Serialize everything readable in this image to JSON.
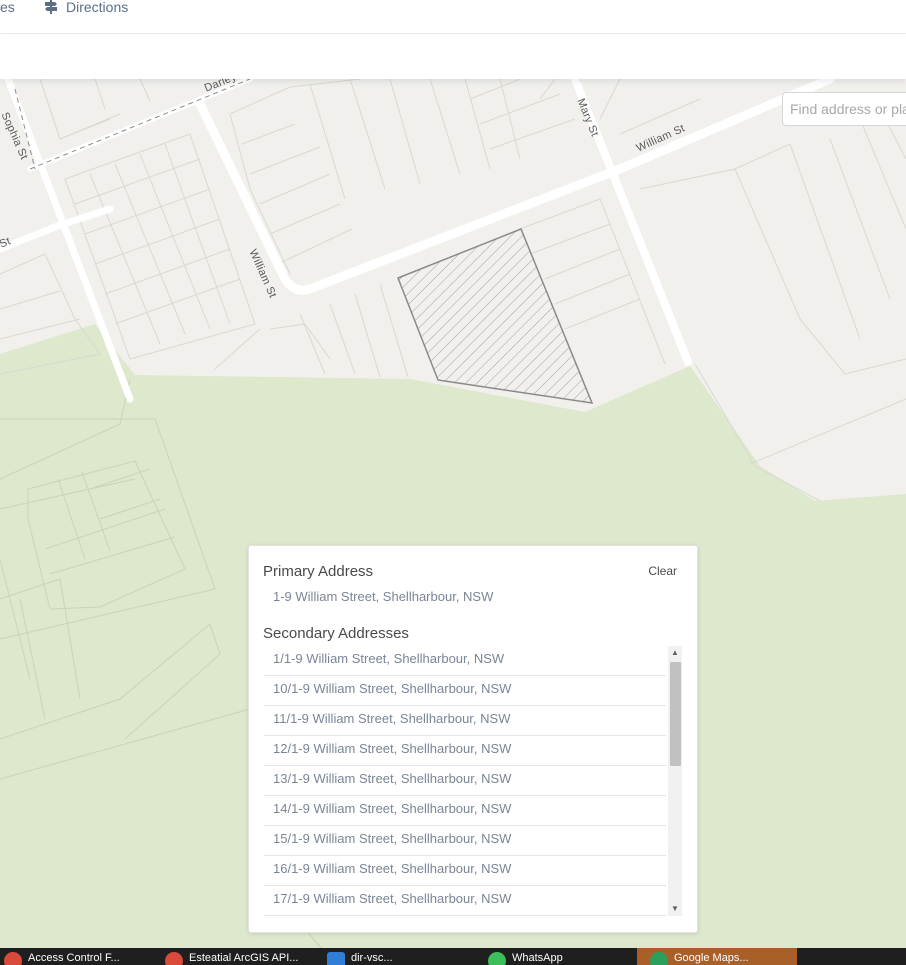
{
  "nav": {
    "tabs_partial_label": "es",
    "directions_label": "Directions"
  },
  "map": {
    "streets": {
      "sophia": "Sophia St",
      "darley": "Darley St",
      "william_main": "William St",
      "william_side": "William St",
      "mary": "Mary St",
      "partial_left": "St"
    },
    "search_placeholder": "Find address or place",
    "colors": {
      "land": "#f1f0ec",
      "park": "#dde8cc",
      "road": "#ffffff",
      "parcel_line": "#d9d8d2",
      "selected_parcel": "#8a8a8a"
    }
  },
  "panel": {
    "primary_title": "Primary Address",
    "clear_label": "Clear",
    "primary_address": "1-9 William Street, Shellharbour, NSW",
    "secondary_title": "Secondary Addresses",
    "secondary_addresses": [
      "1/1-9 William Street, Shellharbour, NSW",
      "10/1-9 William Street, Shellharbour, NSW",
      "11/1-9 William Street, Shellharbour, NSW",
      "12/1-9 William Street, Shellharbour, NSW",
      "13/1-9 William Street, Shellharbour, NSW",
      "14/1-9 William Street, Shellharbour, NSW",
      "15/1-9 William Street, Shellharbour, NSW",
      "16/1-9 William Street, Shellharbour, NSW",
      "17/1-9 William Street, Shellharbour, NSW"
    ]
  },
  "taskbar": {
    "items": [
      "Access Control F...",
      "Esteatial ArcGIS API...",
      "dir-vsc...",
      "WhatsApp",
      "Google Maps..."
    ],
    "active_color": "#a85f28"
  }
}
